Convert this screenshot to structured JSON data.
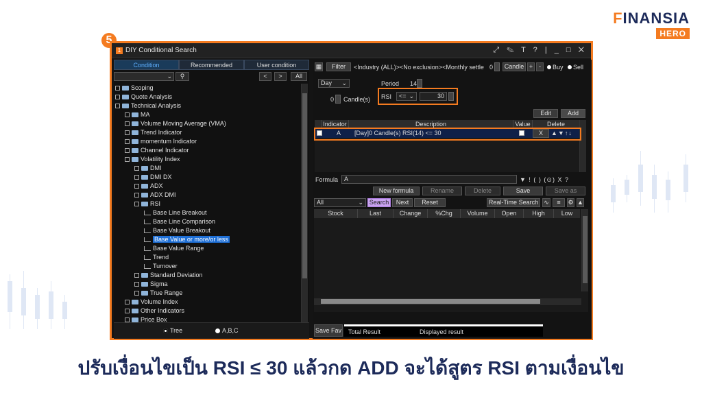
{
  "logo": {
    "main_prefix": "F",
    "main_rest": "INANSIA",
    "sub": "HERO"
  },
  "step_number": "5",
  "window": {
    "index": "1",
    "title": "DIY Conditional Search",
    "controls": "⤢ ✎ T ? | _ □ ✕"
  },
  "left": {
    "tabs": [
      "Condition",
      "Recommended",
      "User condition"
    ],
    "all_button": "All",
    "tree": [
      {
        "label": "Scoping",
        "level": 0,
        "type": "folder"
      },
      {
        "label": "Quote Analysis",
        "level": 0,
        "type": "folder"
      },
      {
        "label": "Technical Analysis",
        "level": 0,
        "type": "folder"
      },
      {
        "label": "MA",
        "level": 1,
        "type": "folder"
      },
      {
        "label": "Volume Moving Average (VMA)",
        "level": 1,
        "type": "folder"
      },
      {
        "label": "Trend Indicator",
        "level": 1,
        "type": "folder"
      },
      {
        "label": "momentum Indicator",
        "level": 1,
        "type": "folder"
      },
      {
        "label": "Channel Indicator",
        "level": 1,
        "type": "folder"
      },
      {
        "label": "Volatility Index",
        "level": 1,
        "type": "folder"
      },
      {
        "label": "DMI",
        "level": 2,
        "type": "folder"
      },
      {
        "label": "DMI DX",
        "level": 2,
        "type": "folder"
      },
      {
        "label": "ADX",
        "level": 2,
        "type": "folder"
      },
      {
        "label": "ADX DMI",
        "level": 2,
        "type": "folder"
      },
      {
        "label": "RSI",
        "level": 2,
        "type": "folder"
      },
      {
        "label": "Base Line Breakout",
        "level": 3,
        "type": "leaf"
      },
      {
        "label": "Base Line Comparison",
        "level": 3,
        "type": "leaf"
      },
      {
        "label": "Base Value Breakout",
        "level": 3,
        "type": "leaf"
      },
      {
        "label": "Base Value or more/or less",
        "level": 3,
        "type": "leaf",
        "selected": true
      },
      {
        "label": "Base Value Range",
        "level": 3,
        "type": "leaf"
      },
      {
        "label": "Trend",
        "level": 3,
        "type": "leaf"
      },
      {
        "label": "Turnover",
        "level": 3,
        "type": "leaf"
      },
      {
        "label": "Standard Deviation",
        "level": 2,
        "type": "folder"
      },
      {
        "label": "Sigma",
        "level": 2,
        "type": "folder"
      },
      {
        "label": "True Range",
        "level": 2,
        "type": "folder"
      },
      {
        "label": "Volume Index",
        "level": 1,
        "type": "folder"
      },
      {
        "label": "Other Indicators",
        "level": 1,
        "type": "folder"
      },
      {
        "label": "Price Box",
        "level": 1,
        "type": "folder"
      }
    ],
    "view_options": [
      "Tree",
      "A,B,C"
    ]
  },
  "right": {
    "filter_button": "Filter",
    "filter_text": "<Industry (ALL)><No exclusion><Monthly settle",
    "candle_value": "0",
    "candle_button": "Candle",
    "plus": "+",
    "minus": "-",
    "buy": "Buy",
    "sell": "Sell",
    "period_select": "Day",
    "period_label": "Period",
    "period_value": "14",
    "candles_value": "0",
    "candles_label": "Candle(s)",
    "rsi_label": "RSI",
    "operator": "<=",
    "threshold": "30",
    "edit_button": "Edit",
    "add_button": "Add",
    "cond_headers": [
      "Indicator",
      "Description",
      "Value",
      "Delete"
    ],
    "condition": {
      "indicator": "A",
      "description": "[Day]0 Candle(s) RSI(14) <= 30",
      "delete": "X"
    },
    "formula_label": "Formula",
    "formula_value": "A",
    "formula_tools": "▼ ! ( ) (⊙) X ?",
    "actions": [
      "New formula",
      "Rename",
      "Delete",
      "Save",
      "Save as"
    ],
    "result_filter": "All",
    "search_button": "Search",
    "next_button": "Next",
    "reset_button": "Reset",
    "realtime_button": "Real-Time Search",
    "result_headers": [
      "Stock",
      "Last",
      "Change",
      "%Chg",
      "Volume",
      "Open",
      "High",
      "Low"
    ],
    "save_fav": "Save Fav",
    "total_result": "Total Result",
    "displayed_result": "Displayed result"
  },
  "caption": "ปรับเงื่อนไขเป็น RSI ≤ 30 แล้วกด ADD จะได้สูตร RSI ตามเงื่อนไข"
}
